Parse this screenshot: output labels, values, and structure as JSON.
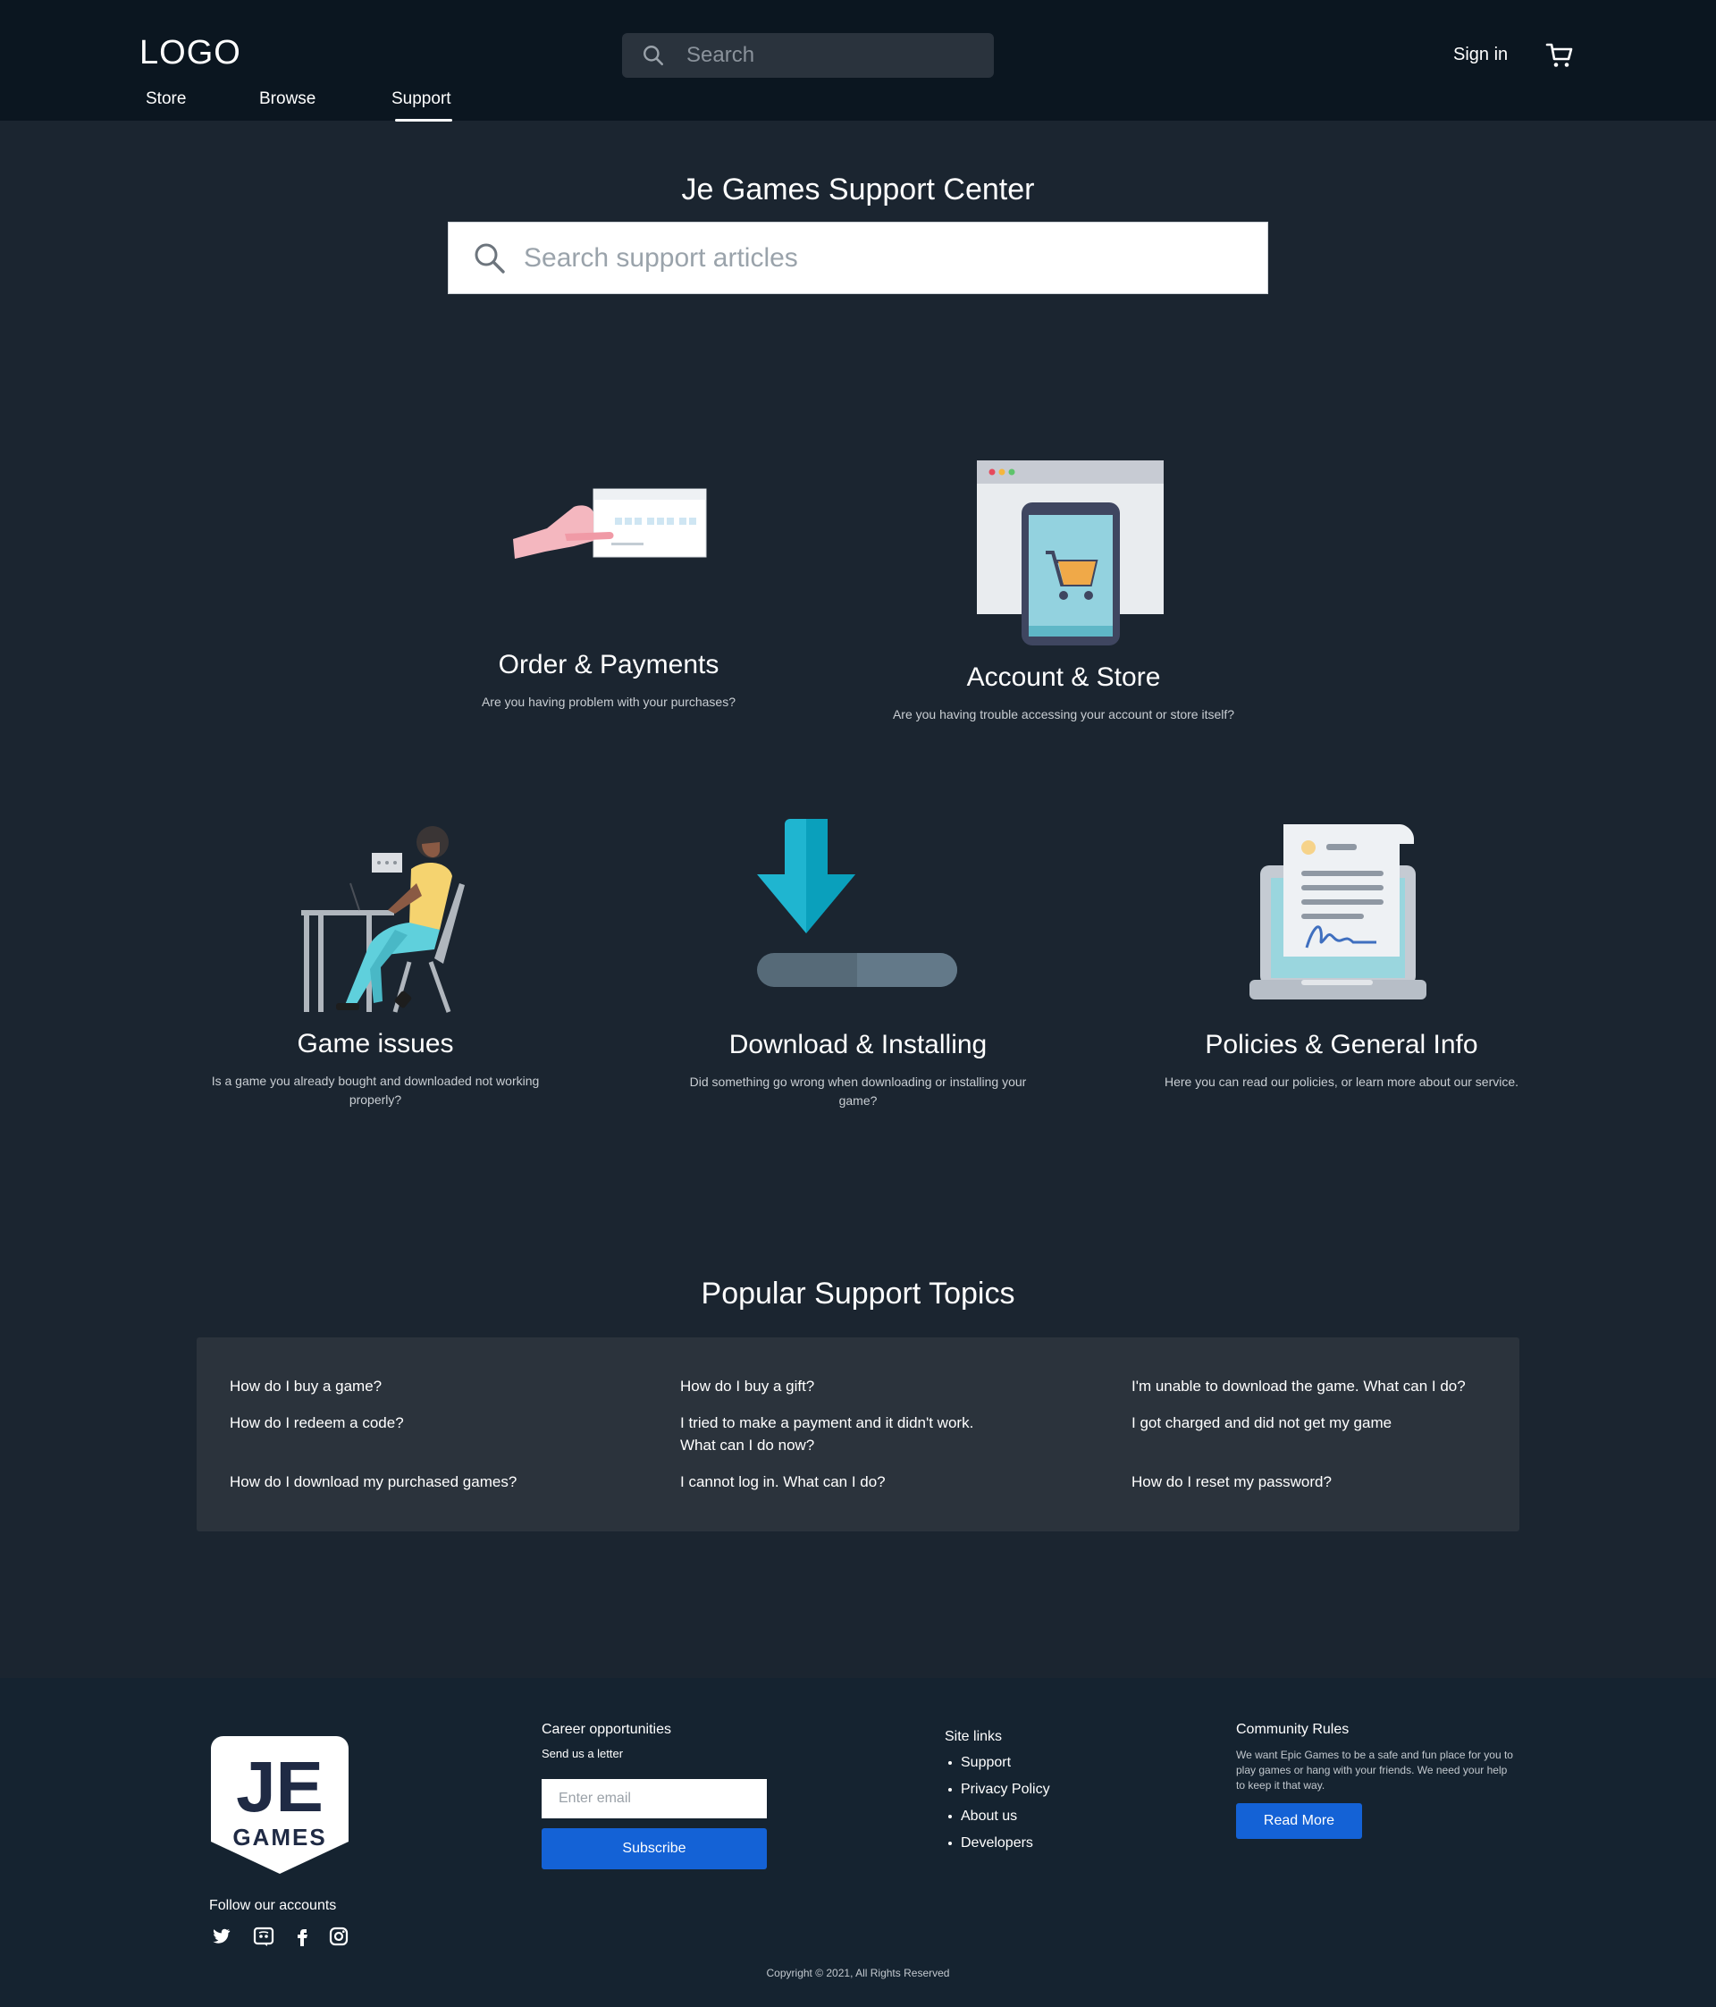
{
  "header": {
    "logo": "LOGO",
    "nav": [
      {
        "label": "Store"
      },
      {
        "label": "Browse"
      },
      {
        "label": "Support"
      }
    ],
    "search_placeholder": "Search",
    "signin_label": "Sign in",
    "active_nav": "Support"
  },
  "hero": {
    "title": "Je Games Support Center",
    "search_placeholder": "Search support articles"
  },
  "categories": [
    {
      "title": "Order & Payments",
      "desc": "Are you having problem with your purchases?",
      "icon": "payment-card-icon"
    },
    {
      "title": "Account & Store",
      "desc": "Are you having trouble accessing your account or store itself?",
      "icon": "phone-store-cart-icon"
    },
    {
      "title": "Game issues",
      "desc": "Is a game you already bought and downloaded not working properly?",
      "icon": "person-at-desk-icon"
    },
    {
      "title": "Download & Installing",
      "desc": "Did something go wrong when downloading or installing your game?",
      "icon": "download-arrow-icon"
    },
    {
      "title": "Policies & General Info",
      "desc": "Here you can read our policies, or learn more about our service.",
      "icon": "document-laptop-icon"
    }
  ],
  "topics": {
    "title": "Popular Support Topics",
    "items": [
      "How do I buy a game?",
      "How do I redeem a code?",
      "How do I download my purchased games?",
      "How do I buy a gift?",
      "I tried to make a payment and it didn't work. What can I do now?",
      "I cannot log in. What can I do?",
      "I'm unable to download the game. What can I do?",
      "I got charged and did not get my game",
      "How do I reset my password?"
    ]
  },
  "footer": {
    "badge_text_top": "JE",
    "badge_text_bottom": "GAMES",
    "follow_label": "Follow our accounts",
    "social_icons": [
      "twitter-icon",
      "discord-icon",
      "facebook-icon",
      "instagram-icon"
    ],
    "career_title": "Career opportunities",
    "career_sub": "Send us a letter",
    "email_placeholder": "Enter email",
    "subscribe_label": "Subscribe",
    "site_links_title": "Site links",
    "site_links": [
      "Support",
      "Privacy Policy",
      "About us",
      "Developers"
    ],
    "rules_title": "Community Rules",
    "rules_text": "We want Epic Games to be a safe and fun place for you to play games or hang with your friends. We need your help to keep it that way.",
    "readmore_label": "Read More",
    "copyright": "Copyright © 2021, All Rights Reserved"
  },
  "colors": {
    "header_bg": "#0b1620",
    "page_bg": "#1b2530",
    "footer_bg": "#152330",
    "accent_button": "#1462d6",
    "topics_box": "#2b333c"
  }
}
